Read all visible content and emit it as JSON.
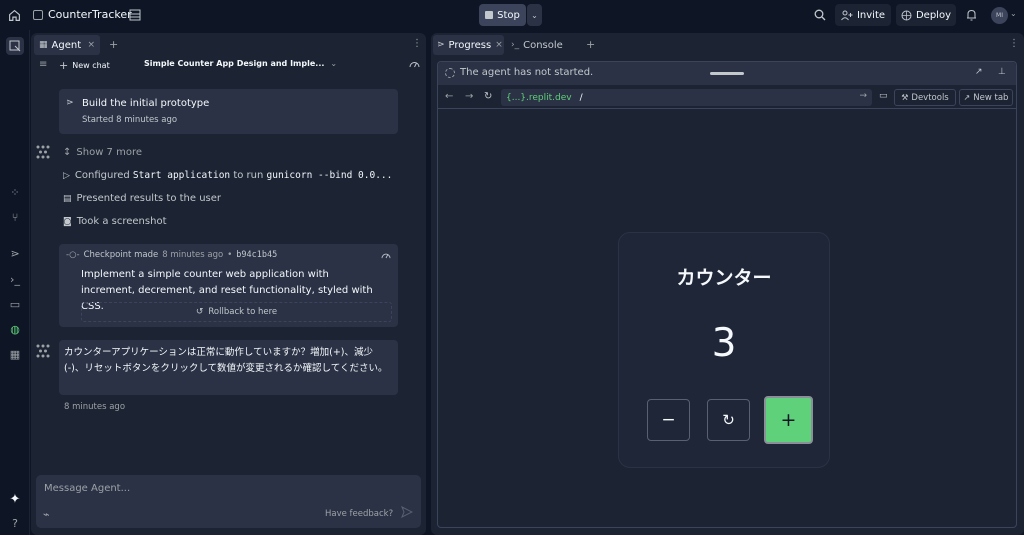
{
  "topbar": {
    "app_name": "CounterTracker",
    "stop_label": "Stop",
    "invite_label": "Invite",
    "deploy_label": "Deploy",
    "avatar_initials": "MI"
  },
  "agent_panel": {
    "tab_label": "Agent",
    "new_chat_label": "New chat",
    "chat_title": "Simple Counter App Design and Imple...",
    "plan_title": "Build the initial prototype",
    "plan_started": "Started 8 minutes ago",
    "show_more": "Show 7 more",
    "step_configured_prefix": "Configured ",
    "step_configured_code": "Start application",
    "step_configured_mid": " to run ",
    "step_configured_cmd": "gunicorn --bind 0.0...",
    "step_presented": "Presented results to the user",
    "step_screenshot": "Took a screenshot",
    "checkpoint_label": "Checkpoint made",
    "checkpoint_time": "8 minutes ago",
    "checkpoint_sep": "•",
    "checkpoint_hash": "b94c1b45",
    "checkpoint_desc": "Implement a simple counter web application with increment, decrement, and reset functionality, styled with CSS.",
    "rollback_label": "Rollback to here",
    "agent_message": "カウンターアプリケーションは正常に動作していますか？増加(+)、減少(-)、リセットボタンをクリックして数値が変更されるか確認してください。",
    "message_time": "8 minutes ago",
    "input_placeholder": "Message Agent...",
    "feedback_label": "Have feedback?"
  },
  "right_panel": {
    "tab_progress": "Progress",
    "tab_console": "Console",
    "status_text": "The agent has not started.",
    "url_host": "{...}.replit.dev",
    "url_path": "/",
    "devtools_label": "Devtools",
    "new_tab_label": "New tab"
  },
  "counter_app": {
    "title": "カウンター",
    "value": "3",
    "decrement_label": "−",
    "increment_label": "+"
  },
  "colors": {
    "accent_green": "#5fd17a",
    "background": "#0e1525",
    "panel": "#1c2333",
    "card": "#2b3245"
  }
}
